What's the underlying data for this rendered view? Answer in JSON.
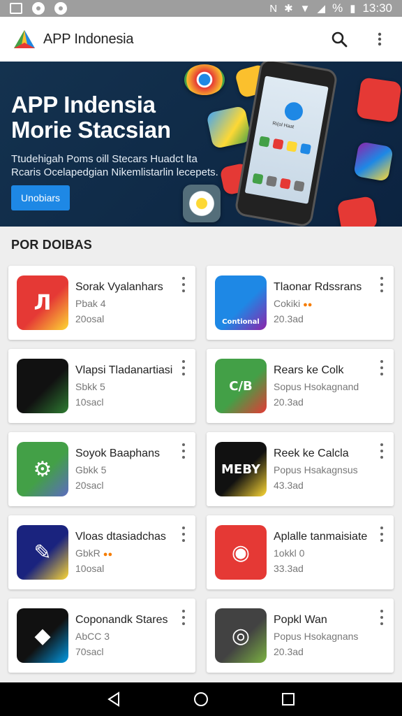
{
  "status_bar": {
    "time": "13:30",
    "battery": "%"
  },
  "app_bar": {
    "title": "APP Indonesia"
  },
  "banner": {
    "title_line1": "APP Indensia",
    "title_line2": "Morie Stacsian",
    "subtitle": "Ttudehigah Poms oill Stecars Huadct lta Rcaris Ocelapedgian Nikemlistarlin lecepets.",
    "button_label": "Unobiars",
    "phone_label": "Ri(ol Haat"
  },
  "section": {
    "title": "POR DOIBAS"
  },
  "apps": [
    {
      "name": "Sorak Vyalanhars",
      "meta": "Pbak 4",
      "size": "20osal",
      "meta_badge": "",
      "icon": "music-app-icon",
      "icon_text": "Л",
      "colors": [
        "#e53935",
        "#fdd835"
      ]
    },
    {
      "name": "Tlaonar Rdssrans",
      "meta": "Cokiki",
      "size": "20.3ad",
      "meta_badge": "●●",
      "icon": "camera-lens-icon",
      "icon_text": "Contional",
      "colors": [
        "#1e88e5",
        "#8e24aa"
      ]
    },
    {
      "name": "Vlapsi Tladanartiasi",
      "meta": "Sbkk 5",
      "size": "10sacl",
      "meta_badge": "",
      "icon": "green-triangle-icon",
      "icon_text": "",
      "colors": [
        "#111111",
        "#2e7d32"
      ]
    },
    {
      "name": "Rears ke Colk",
      "meta": "Sopus Hsokagnand",
      "size": "20.3ad",
      "meta_badge": "",
      "icon": "shield-cb-icon",
      "icon_text": "C/B",
      "colors": [
        "#43a047",
        "#e53935"
      ]
    },
    {
      "name": "Soyok Baaphans",
      "meta": "Gbkk 5",
      "size": "20sacl",
      "meta_badge": "",
      "icon": "gear-app-icon",
      "icon_text": "⚙",
      "colors": [
        "#43a047",
        "#5c6bc0"
      ]
    },
    {
      "name": "Reek ke Calcla",
      "meta": "Popus Hsakagnsus",
      "size": "43.3ad",
      "meta_badge": "",
      "icon": "meby-icon",
      "icon_text": "MEBY",
      "colors": [
        "#111111",
        "#fdd835"
      ]
    },
    {
      "name": "Vloas dtasiadchas",
      "meta": "GbkR",
      "size": "10osal",
      "meta_badge": "●●",
      "icon": "tools-icon",
      "icon_text": "✎",
      "colors": [
        "#1a237e",
        "#fdd835"
      ]
    },
    {
      "name": "Aplalle tanmaisiate",
      "meta": "1okkl 0",
      "size": "33.3ad",
      "meta_badge": "",
      "icon": "signal-pin-icon",
      "icon_text": "◉",
      "colors": [
        "#e53935",
        "#e53935"
      ]
    },
    {
      "name": "Coponandk Stares",
      "meta": "AbCC 3",
      "size": "70sacl",
      "meta_badge": "",
      "icon": "blue-arrow-icon",
      "icon_text": "◆",
      "colors": [
        "#111111",
        "#039be5"
      ]
    },
    {
      "name": "Popkl Wan",
      "meta": "Popus Hsokagnans",
      "size": "20.3ad",
      "meta_badge": "",
      "icon": "disc-icon",
      "icon_text": "◎",
      "colors": [
        "#424242",
        "#7cb342"
      ]
    }
  ]
}
